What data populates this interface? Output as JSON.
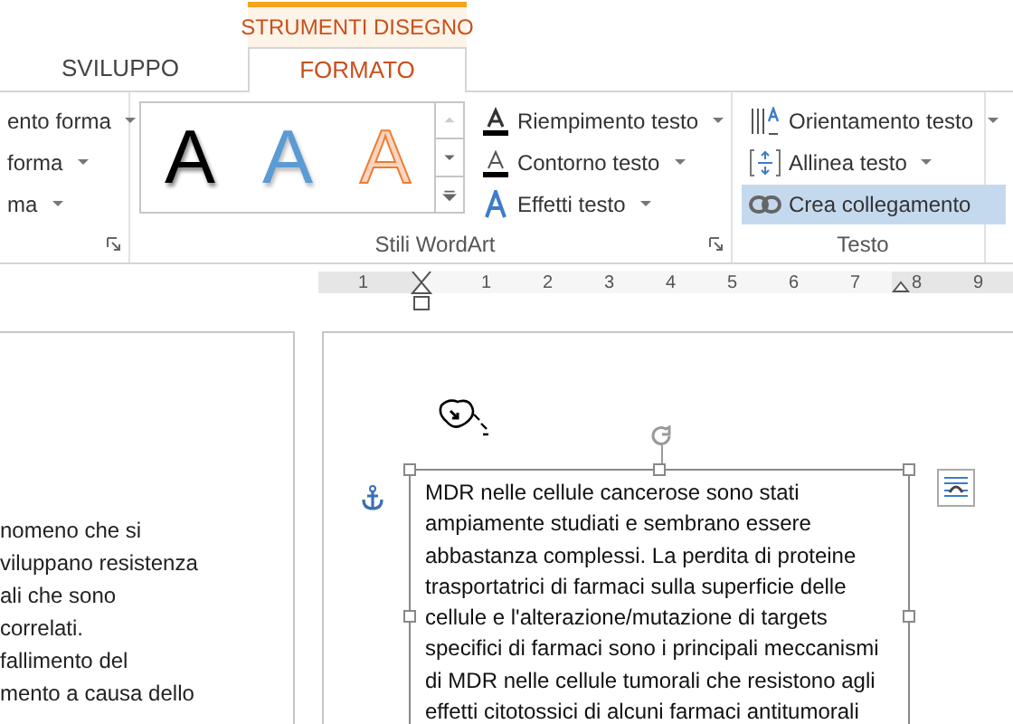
{
  "tabs": [
    {
      "label": "SVILUPPO",
      "selected": false
    },
    {
      "label": "FORMATO",
      "selected": true,
      "context": "STRUMENTI DISEGNO"
    }
  ],
  "ribbon": {
    "groups": [
      {
        "kind": "list",
        "items": [
          {
            "label": "ento forma",
            "kind": "dropdown",
            "highlighted": false
          },
          {
            "label": "forma",
            "kind": "dropdown",
            "highlighted": false
          },
          {
            "label": "ma",
            "kind": "dropdown",
            "highlighted": false
          }
        ]
      },
      {
        "kind": "gallery",
        "label": "Stili WordArt",
        "styles": [
          {
            "letter": "A",
            "kind": "black"
          },
          {
            "letter": "A",
            "kind": "blue"
          },
          {
            "letter": "A",
            "kind": "orange"
          }
        ],
        "items": [
          {
            "label": "Riempimento testo",
            "kind": "dropdown",
            "highlighted": false
          },
          {
            "label": "Contorno testo",
            "kind": "dropdown",
            "highlighted": false
          },
          {
            "label": "Effetti testo",
            "kind": "dropdown",
            "highlighted": false
          }
        ]
      },
      {
        "kind": "list",
        "label": "Testo",
        "items": [
          {
            "label": "Orientamento testo",
            "kind": "dropdown",
            "highlighted": false
          },
          {
            "label": "Allinea testo",
            "kind": "dropdown",
            "highlighted": false
          },
          {
            "label": "Crea collegamento",
            "kind": "button",
            "highlighted": true
          }
        ]
      }
    ]
  },
  "ruler": {
    "labels": [
      "1",
      "1",
      "2",
      "3",
      "4",
      "5",
      "6",
      "7",
      "8",
      "9"
    ]
  },
  "left_page": {
    "lines": [
      "nomeno che si",
      "viluppano resistenza",
      "ali che sono",
      "correlati.",
      "fallimento del",
      "mento a causa dello"
    ]
  },
  "text_box": {
    "text": "MDR nelle cellule cancerose sono stati ampiamente studiati e sembrano essere abbastanza complessi. La perdita di proteine trasportatrici di farmaci sulla superficie delle cellule e l'alterazione/mutazione di targets specifici di farmaci sono i principali meccanismi di MDR nelle cellule tumorali che resistono agli effetti citotossici di alcuni farmaci antitumorali"
  }
}
